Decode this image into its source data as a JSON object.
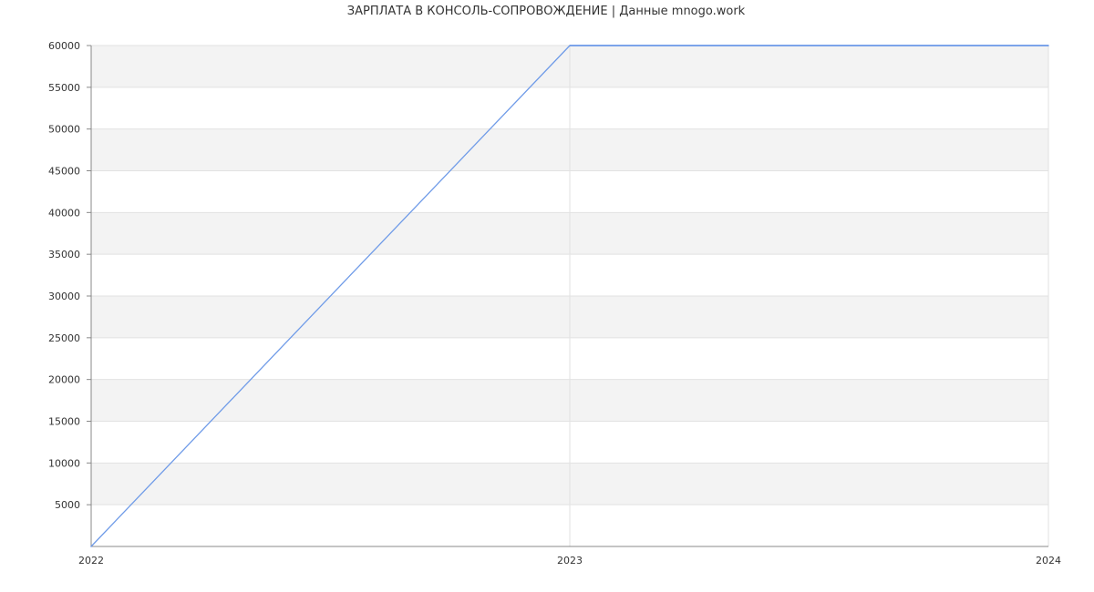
{
  "chart_data": {
    "type": "line",
    "title": "ЗАРПЛАТА В  КОНСОЛЬ-СОПРОВОЖДЕНИЕ | Данные mnogo.work",
    "xlabel": "",
    "ylabel": "",
    "x": [
      2022,
      2023,
      2024
    ],
    "xticks": [
      "2022",
      "2023",
      "2024"
    ],
    "xlim": [
      2022,
      2024
    ],
    "ylim": [
      0,
      60000
    ],
    "yticks": [
      5000,
      10000,
      15000,
      20000,
      25000,
      30000,
      35000,
      40000,
      45000,
      50000,
      55000,
      60000
    ],
    "ytick_labels": [
      "5000",
      "10000",
      "15000",
      "20000",
      "25000",
      "30000",
      "35000",
      "40000",
      "45000",
      "50000",
      "55000",
      "60000"
    ],
    "series": [
      {
        "values": [
          0,
          60000,
          60000
        ],
        "color": "#6f9be8"
      }
    ],
    "grid": true,
    "band_color": "#f3f3f3",
    "grid_color": "#e2e2e2",
    "axis_color": "#888888",
    "legend": "none"
  }
}
